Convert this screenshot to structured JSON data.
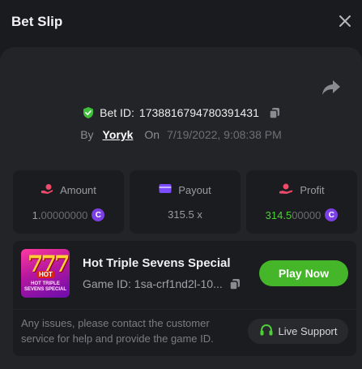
{
  "header": {
    "title": "Bet Slip",
    "close_icon": "close-icon"
  },
  "bet": {
    "id_label": "Bet ID:",
    "id_value": "1738816794780391431",
    "by_label": "By",
    "user": "Yoryk",
    "on_label": "On",
    "date": "7/19/2022, 9:08:38 PM"
  },
  "stats": {
    "amount": {
      "label": "Amount",
      "value_main": "1.",
      "value_dim": "00000000",
      "icon": "coins-icon",
      "icon_color": "#f04a6b"
    },
    "payout": {
      "label": "Payout",
      "value": "315.5 x",
      "icon": "wallet-icon",
      "icon_color": "#7c4dff"
    },
    "profit": {
      "label": "Profit",
      "value_main": "314.5",
      "value_dim": "00000",
      "icon": "profit-hand-icon",
      "icon_color": "#f04a6b"
    },
    "currency_icon": "currency-coin-icon",
    "currency_symbol": "C"
  },
  "game": {
    "title": "Hot Triple Sevens Special",
    "id_label": "Game ID:",
    "id_value": "1sa-crf1nd2l-10...",
    "id_full_display": "Game ID: 1sa-crf1nd2l-10...",
    "thumb_number": "777",
    "thumb_badge": "HOT",
    "thumb_line1": "HOT TRIPLE",
    "thumb_line2": "SEVENS SPECIAL",
    "play_label": "Play Now"
  },
  "support": {
    "notice": "Any issues, please contact the customer service for help and provide the game ID.",
    "button_label": "Live Support"
  },
  "colors": {
    "background": "#1a1b1e",
    "panel": "#232427",
    "card": "#1b1c1f",
    "accent_green": "#45b62a",
    "profit_green": "#4cd137",
    "coin_purple": "#7b3fe4"
  }
}
